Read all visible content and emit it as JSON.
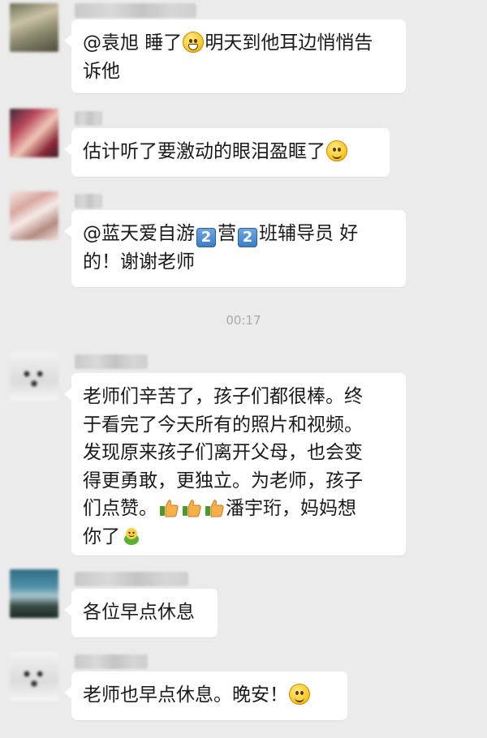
{
  "messages": [
    {
      "text_1": "@袁旭  睡了",
      "text_2": "明天到他耳边悄悄告",
      "text_3": "诉他"
    },
    {
      "text": "估计听了要激动的眼泪盈眶了"
    },
    {
      "text_1": "@蓝天爱自游",
      "key_1": "2",
      "text_2": "营",
      "key_2": "2",
      "text_3": "班辅导员 好",
      "text_4": "的！谢谢老师"
    },
    {
      "line_1": "老师们辛苦了，孩子们都很棒。终",
      "line_2": "于看完了今天所有的照片和视频。",
      "line_3": "发现原来孩子们离开父母，也会变",
      "line_4": "得更勇敢，更独立。为老师，孩子",
      "line_5a": "们点赞。",
      "line_5b": "潘宇珩，妈妈想",
      "line_6": "你了"
    },
    {
      "text": "各位早点休息"
    },
    {
      "text": "老师也早点休息。晚安！"
    }
  ],
  "timestamp": "00:17",
  "icons": {
    "grin": "grinning-face-icon",
    "smile": "smiling-face-icon",
    "thumbs": "thumbs-up-icon",
    "frog": "green-frog-icon",
    "key": "number-key-icon"
  },
  "colors": {
    "background": "#ebebeb",
    "bubble": "#ffffff",
    "text": "#1a1a1a",
    "timestamp": "#a9a9a9"
  }
}
